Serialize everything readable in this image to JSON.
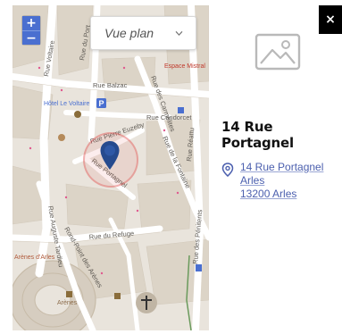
{
  "map": {
    "zoom_in_label": "+",
    "zoom_out_label": "−",
    "view_select_label": "Vue plan",
    "street_labels": [
      "Rue Balzac",
      "Rue du Port",
      "Rue Voltaire",
      "Rue Condorcet",
      "Rue Pierre Euzeby",
      "Rue Portagnel",
      "Rue Auguste Tardieu",
      "Rue de la Fontaine",
      "Rue du Refuge",
      "Rond-Point des Arènes",
      "Rue des Carmélites",
      "Rue Réattu",
      "Rue des Pénitents"
    ],
    "poi_labels": [
      "Hôtel Le Voltaire",
      "Espace Mistral",
      "Arènes d'Arles",
      "Arènes"
    ],
    "colors": {
      "land": "#e9e4dc",
      "block": "#dcd4c7",
      "road": "#ffffff",
      "marker": "#264a8e",
      "accent": "#4a6fd0"
    }
  },
  "panel": {
    "close_label": "×",
    "place_title": "14 Rue Portagnel",
    "address_lines": [
      "14 Rue Portagnel",
      "Arles",
      "13200 Arles"
    ]
  }
}
